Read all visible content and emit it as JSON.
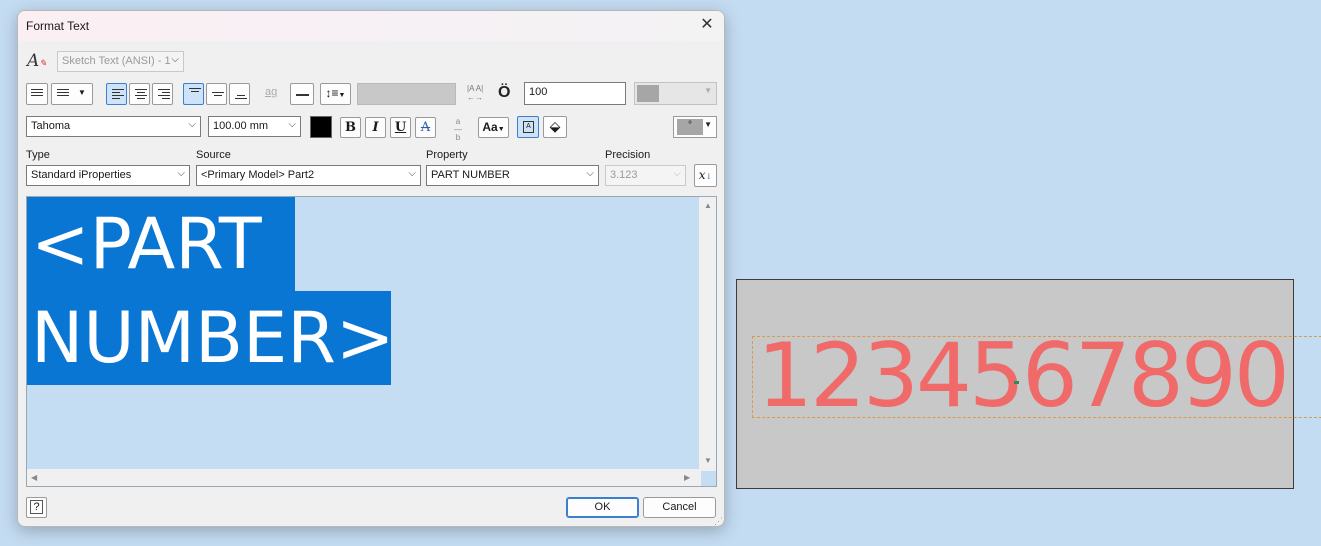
{
  "dialog": {
    "title": "Format Text",
    "style_value": "Sketch Text (ANSI) - 1",
    "stretch_value": "100",
    "font": "Tahoma",
    "font_size": "100.00 mm",
    "bold_label": "B",
    "italic_label": "I",
    "underline_label": "U",
    "strike_label": "A",
    "type_label": "Type",
    "type_value": "Standard iProperties",
    "source_label": "Source",
    "source_value": "<Primary Model> Part2",
    "property_label": "Property",
    "property_value": "PART NUMBER",
    "precision_label": "Precision",
    "precision_value": "3.123",
    "symbol_label": "°",
    "editor_line1": "<PART",
    "editor_line2": "NUMBER>",
    "ok_label": "OK",
    "cancel_label": "Cancel",
    "help_label": "?"
  },
  "sketch": {
    "text": "1234567890"
  },
  "colors": {
    "selection": "#0a76d4",
    "sketch_text": "#f16a6a",
    "desktop": "#c4dcf2"
  }
}
